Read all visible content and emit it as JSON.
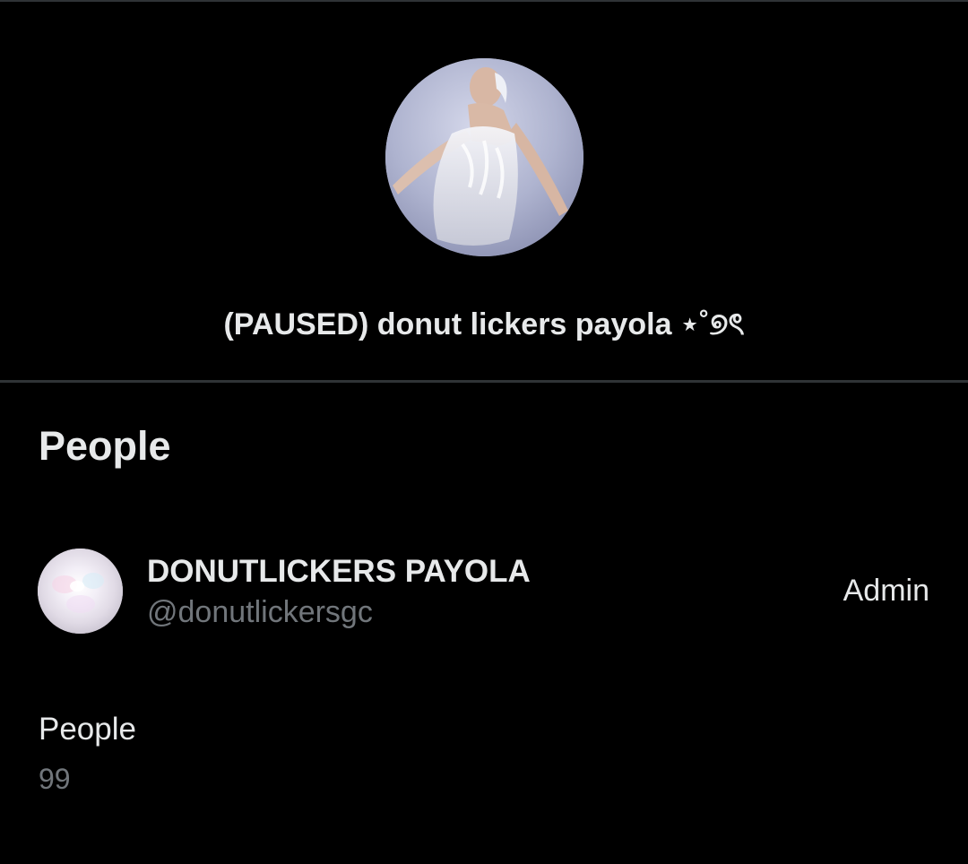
{
  "group": {
    "title": "(PAUSED) donut lickers payola ⋆˚୭ৎ"
  },
  "people_section": {
    "heading": "People",
    "members": [
      {
        "display_name": "DONUTLICKERS PAYOLA",
        "handle": "@donutlickersgc",
        "role": "Admin"
      }
    ]
  },
  "stats": {
    "label": "People",
    "value": "99"
  },
  "colors": {
    "background": "#000000",
    "primary_text": "#e7e9ea",
    "secondary_text": "#71767b",
    "divider": "#2f3336"
  }
}
